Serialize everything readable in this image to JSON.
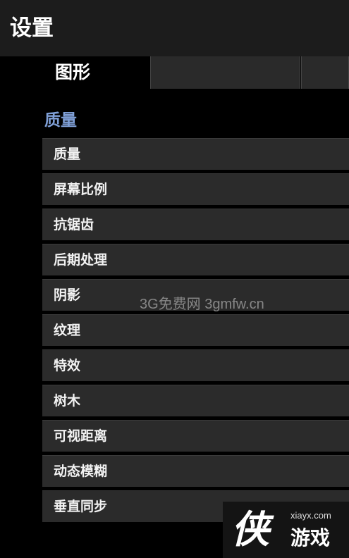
{
  "header": {
    "title": "设置"
  },
  "tabs": [
    {
      "label": "图形",
      "active": true
    },
    {
      "label": "",
      "active": false
    },
    {
      "label": "",
      "active": false
    }
  ],
  "section": {
    "title": "质量"
  },
  "items": [
    {
      "label": "质量"
    },
    {
      "label": "屏幕比例"
    },
    {
      "label": "抗锯齿"
    },
    {
      "label": "后期处理"
    },
    {
      "label": "阴影"
    },
    {
      "label": "纹理"
    },
    {
      "label": "特效"
    },
    {
      "label": "树木"
    },
    {
      "label": "可视距离"
    },
    {
      "label": "动态模糊"
    },
    {
      "label": "垂直同步"
    }
  ],
  "watermark": {
    "text": "3G免费网 3gmfw.cn"
  },
  "logo": {
    "mark": "侠",
    "url": "xiayx.com",
    "text": "游戏"
  },
  "colors": {
    "accent": "#7f9fd6",
    "row_bg": "#2b2b2b",
    "header_bg": "#1c1c1c"
  }
}
